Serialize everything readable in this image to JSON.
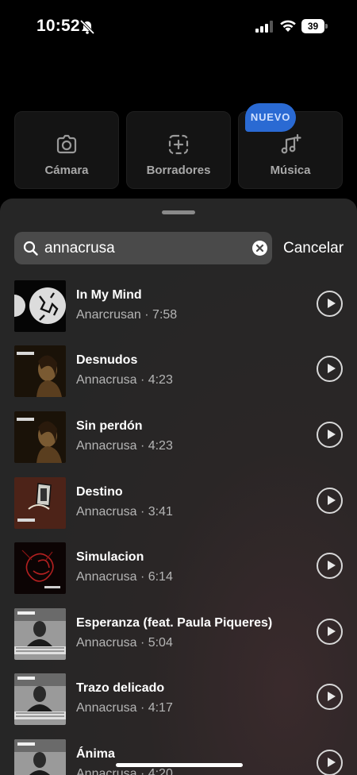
{
  "status_bar": {
    "time": "10:52",
    "battery": "39"
  },
  "tiles": [
    {
      "label": "Cámara",
      "icon": "camera-icon"
    },
    {
      "label": "Borradores",
      "icon": "drafts-icon"
    },
    {
      "label": "Música",
      "icon": "music-add-icon"
    }
  ],
  "badge": "NUEVO",
  "search": {
    "value": "annacrusa",
    "cancel": "Cancelar"
  },
  "results": [
    {
      "title": "In My Mind",
      "subtitle": "Anarcrusan · 7:58"
    },
    {
      "title": "Desnudos",
      "subtitle": "Annacrusa · 4:23"
    },
    {
      "title": "Sin perdón",
      "subtitle": "Annacrusa · 4:23"
    },
    {
      "title": "Destino",
      "subtitle": "Annacrusa · 3:41"
    },
    {
      "title": "Simulacion",
      "subtitle": "Annacrusa · 6:14"
    },
    {
      "title": "Esperanza (feat. Paula Piqueres)",
      "subtitle": "Annacrusa · 5:04"
    },
    {
      "title": "Trazo delicado",
      "subtitle": "Annacrusa · 4:17"
    },
    {
      "title": "Ánima",
      "subtitle": "Annacrusa · 4:20"
    }
  ],
  "colors": {
    "badge": "#2a6ad3",
    "sheet": "#262626",
    "search_field": "#4a4a4a"
  }
}
